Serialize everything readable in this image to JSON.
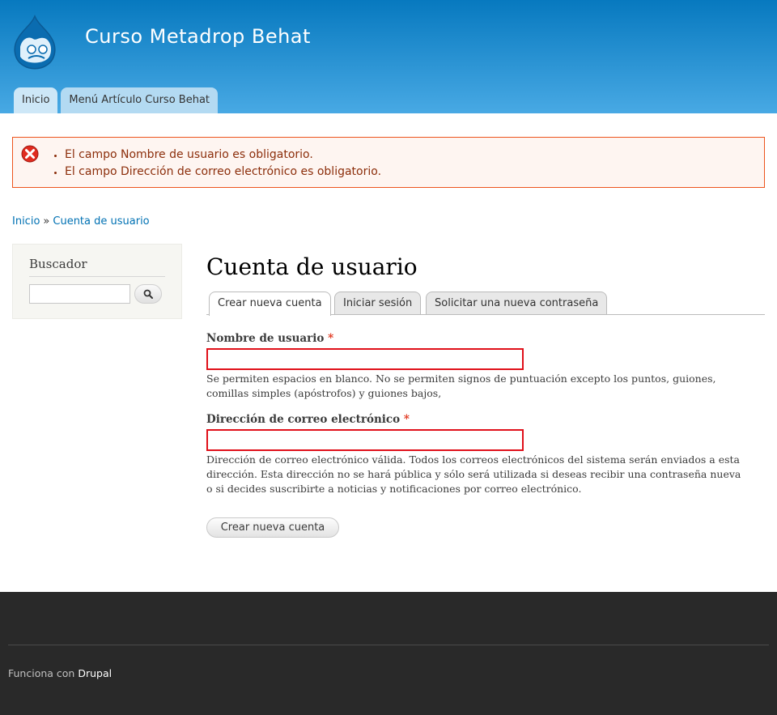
{
  "header": {
    "site_name": "Curso Metadrop Behat",
    "logo_icon": "drupal-drop-icon",
    "menu": [
      {
        "label": "Inicio"
      },
      {
        "label": "Menú Artículo Curso Behat"
      }
    ]
  },
  "messages": {
    "icon": "error-icon",
    "items": [
      "El campo Nombre de usuario es obligatorio.",
      "El campo Dirección de correo electrónico es obligatorio."
    ]
  },
  "breadcrumb": {
    "home": "Inicio",
    "separator": "»",
    "current": "Cuenta de usuario"
  },
  "sidebar": {
    "search_title": "Buscador",
    "search_value": "",
    "search_icon": "search-icon"
  },
  "page": {
    "title": "Cuenta de usuario",
    "tabs": [
      {
        "label": "Crear nueva cuenta",
        "active": true
      },
      {
        "label": "Iniciar sesión"
      },
      {
        "label": "Solicitar una nueva contraseña"
      }
    ]
  },
  "form": {
    "username": {
      "label": "Nombre de usuario",
      "required_marker": "*",
      "value": "",
      "description": "Se permiten espacios en blanco. No se permiten signos de puntuación excepto los puntos, guiones, comillas simples (apóstrofos) y guiones bajos,"
    },
    "email": {
      "label": "Dirección de correo electrónico",
      "required_marker": "*",
      "value": "",
      "description": "Dirección de correo electrónico válida. Todos los correos electrónicos del sistema serán enviados a esta dirección. Esta dirección no se hará pública y sólo será utilizada si deseas recibir una contraseña nueva o si decides suscribirte a noticias y notificaciones por correo electrónico."
    },
    "submit_label": "Crear nueva cuenta"
  },
  "footer": {
    "powered_prefix": "Funciona con",
    "powered_link": "Drupal"
  },
  "colors": {
    "header_top": "#0779bf",
    "header_bottom": "#48a9e4",
    "error_text": "#8c2e0b",
    "error_border": "#ed541d",
    "link": "#0071b3",
    "footer_bg": "#292929"
  }
}
